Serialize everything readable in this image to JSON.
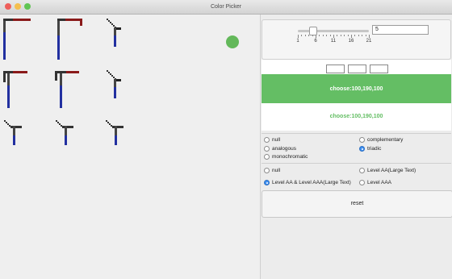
{
  "window": {
    "title": "Color Picker",
    "traffic_colors": [
      "#ee5f5b",
      "#f4bf4f",
      "#61c554"
    ]
  },
  "canvas": {
    "circle_color": "#63b85a"
  },
  "slider": {
    "tick_labels": [
      "1",
      "6",
      "11",
      "16",
      "21"
    ],
    "value": "5",
    "min": 1,
    "max": 21
  },
  "display": {
    "green_color": "#64be64",
    "text_color": "#64be64",
    "choose_label": "choose:100,190,100",
    "choose_label_2": "choose:100,190,100"
  },
  "scheme": {
    "options": [
      "null",
      "complementary",
      "analogous",
      "triadic",
      "monochromatic"
    ],
    "selected": "triadic"
  },
  "contrast": {
    "options": [
      "null",
      "Level AA(Large Text)",
      "Level AA & Level AAA(Large Text)",
      "Level AAA"
    ],
    "selected": "Level AA & Level AAA(Large Text)"
  },
  "reset_label": "reset"
}
